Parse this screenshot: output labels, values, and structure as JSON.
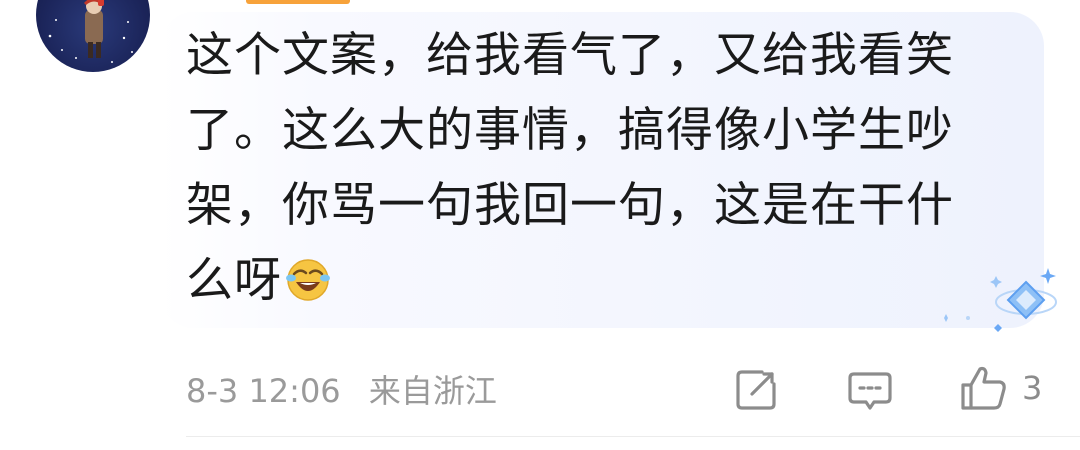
{
  "comment": {
    "lines": [
      "这个文案，给我看气了，又给我看笑",
      "了。这么大的事情，搞得像小学生吵",
      "架，你骂一句我回一句，这是在干什",
      "么呀"
    ],
    "emoji": "laughing-crying-emoji"
  },
  "meta": {
    "time": "8-3 12:06",
    "location": "来自浙江"
  },
  "actions": {
    "like_count": "3",
    "edit_icon": "edit-icon",
    "reply_icon": "comment-icon",
    "like_icon": "thumbs-up-icon"
  },
  "colors": {
    "text": "#1a1a1a",
    "meta": "#9a9a9a",
    "bubble": "#eef2fd",
    "accent": "#f7a23a",
    "vip_blue": "#6aa8f5"
  }
}
